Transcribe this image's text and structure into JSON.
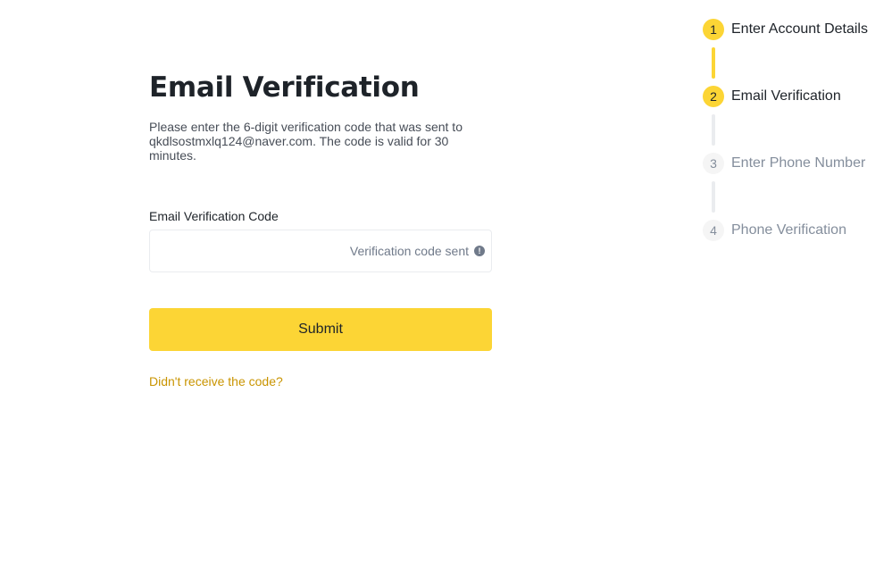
{
  "form": {
    "title": "Email Verification",
    "description": "Please enter the 6-digit verification code that was sent to qkdlsostmxlq124@naver.com. The code is valid for 30 minutes.",
    "field_label": "Email Verification Code",
    "input_value": "",
    "input_placeholder": "",
    "status_text": "Verification code sent",
    "status_icon": "alert-circle-icon",
    "submit_label": "Submit",
    "resend_link": "Didn't receive the code?"
  },
  "steps": [
    {
      "number": "1",
      "label": "Enter Account Details",
      "state": "active"
    },
    {
      "number": "2",
      "label": "Email Verification",
      "state": "active"
    },
    {
      "number": "3",
      "label": "Enter Phone Number",
      "state": "inactive"
    },
    {
      "number": "4",
      "label": "Phone Verification",
      "state": "inactive"
    }
  ],
  "colors": {
    "accent": "#fcd535",
    "link": "#c99400",
    "text_primary": "#1e2329",
    "text_muted": "#848e9c",
    "border": "#eaecef"
  }
}
